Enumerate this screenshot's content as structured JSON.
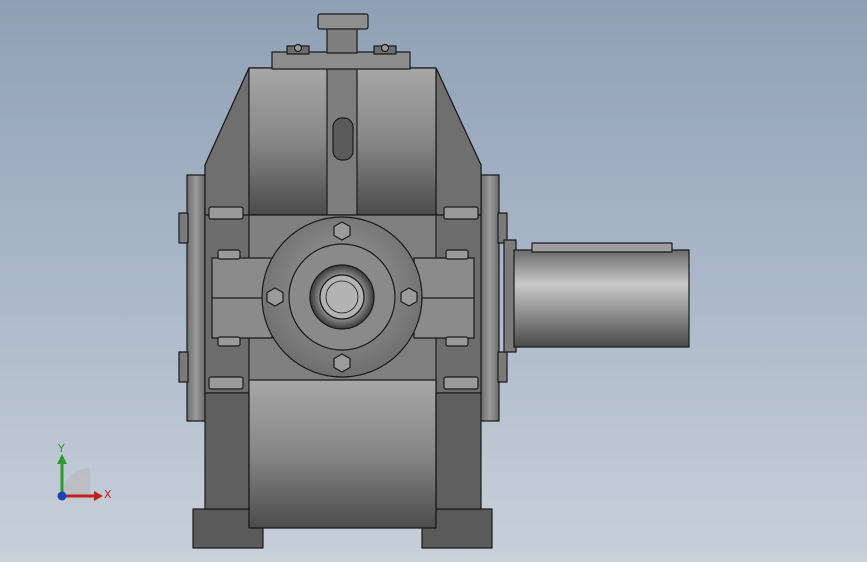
{
  "viewport": {
    "background_top": "#8fa0b6",
    "background_bottom": "#c8d0da"
  },
  "model": {
    "name": "gearbox-front-view",
    "body_color": "#8c8c8c",
    "edge_color": "#1a1a1a"
  },
  "triad": {
    "x_label": "X",
    "y_label": "Y",
    "x_color": "#c0221b",
    "y_color": "#2e9a2e",
    "z_color": "#1f3fb8"
  }
}
